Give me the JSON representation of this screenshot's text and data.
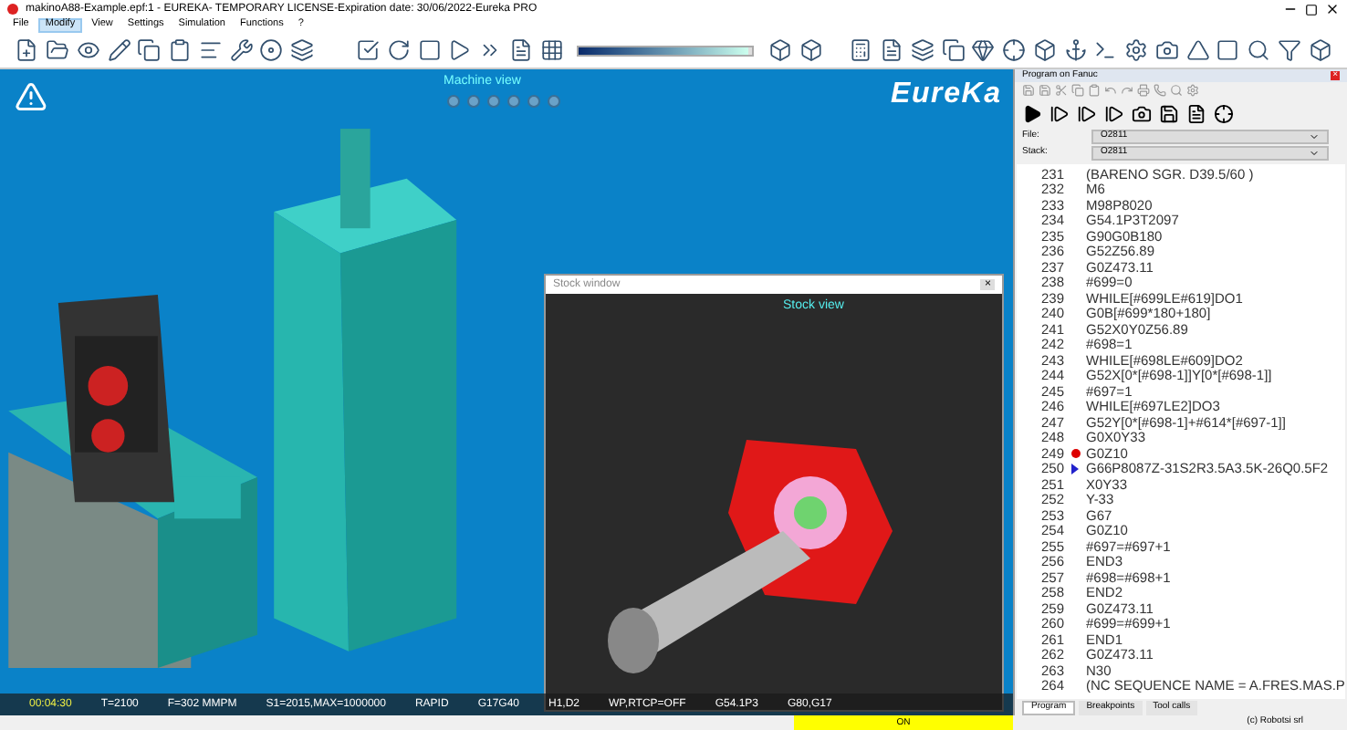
{
  "window": {
    "title": "makinoA88-Example.epf:1 - EUREKA- TEMPORARY LICENSE-Expiration date: 30/06/2022-Eureka PRO"
  },
  "menu": [
    {
      "label": "File",
      "selected": false
    },
    {
      "label": "Modify",
      "selected": true
    },
    {
      "label": "View",
      "selected": false
    },
    {
      "label": "Settings",
      "selected": false
    },
    {
      "label": "Simulation",
      "selected": false
    },
    {
      "label": "Functions",
      "selected": false
    },
    {
      "label": "?",
      "selected": false
    }
  ],
  "toolbar": {
    "speed": {
      "level": 0.98
    }
  },
  "viewport": {
    "title": "Machine view",
    "logo": "EureKa",
    "stock_window": {
      "title": "Stock window",
      "view_title": "Stock view",
      "close": "×"
    }
  },
  "status_bar": [
    "00:04:30",
    "T=2100",
    "F=302 MMPM",
    "S1=2015,MAX=1000000",
    "RAPID",
    "G17G40",
    "H1,D2",
    "WP,RTCP=OFF",
    "G54.1P3",
    "G80,G17"
  ],
  "program": {
    "title": "Program on Fanuc",
    "close": "×",
    "file": {
      "label": "File:",
      "value": "O2811"
    },
    "stack": {
      "label": "Stack:",
      "value": "O2811"
    },
    "lines": [
      {
        "n": "231",
        "code": "(BARENO SGR. D39.5/60 )",
        "breakpoint": false,
        "current": false
      },
      {
        "n": "232",
        "code": "M6",
        "breakpoint": false,
        "current": false
      },
      {
        "n": "233",
        "code": "M98P8020",
        "breakpoint": false,
        "current": false
      },
      {
        "n": "234",
        "code": "G54.1P3T2097",
        "breakpoint": false,
        "current": false
      },
      {
        "n": "235",
        "code": "G90G0B180",
        "breakpoint": false,
        "current": false
      },
      {
        "n": "236",
        "code": "G52Z56.89",
        "breakpoint": false,
        "current": false
      },
      {
        "n": "237",
        "code": "G0Z473.11",
        "breakpoint": false,
        "current": false
      },
      {
        "n": "238",
        "code": "#699=0",
        "breakpoint": false,
        "current": false
      },
      {
        "n": "239",
        "code": "WHILE[#699LE#619]DO1",
        "breakpoint": false,
        "current": false
      },
      {
        "n": "240",
        "code": "G0B[#699*180+180]",
        "breakpoint": false,
        "current": false
      },
      {
        "n": "241",
        "code": "G52X0Y0Z56.89",
        "breakpoint": false,
        "current": false
      },
      {
        "n": "242",
        "code": "#698=1",
        "breakpoint": false,
        "current": false
      },
      {
        "n": "243",
        "code": "WHILE[#698LE#609]DO2",
        "breakpoint": false,
        "current": false
      },
      {
        "n": "244",
        "code": "G52X[0*[#698-1]]Y[0*[#698-1]]",
        "breakpoint": false,
        "current": false
      },
      {
        "n": "245",
        "code": "#697=1",
        "breakpoint": false,
        "current": false
      },
      {
        "n": "246",
        "code": "WHILE[#697LE2]DO3",
        "breakpoint": false,
        "current": false
      },
      {
        "n": "247",
        "code": "G52Y[0*[#698-1]+#614*[#697-1]]",
        "breakpoint": false,
        "current": false
      },
      {
        "n": "248",
        "code": "G0X0Y33",
        "breakpoint": false,
        "current": false
      },
      {
        "n": "249",
        "code": "G0Z10",
        "breakpoint": true,
        "current": false
      },
      {
        "n": "250",
        "code": "G66P8087Z-31S2R3.5A3.5K-26Q0.5F2",
        "breakpoint": false,
        "current": true
      },
      {
        "n": "251",
        "code": "X0Y33",
        "breakpoint": false,
        "current": false
      },
      {
        "n": "252",
        "code": "Y-33",
        "breakpoint": false,
        "current": false
      },
      {
        "n": "253",
        "code": "G67",
        "breakpoint": false,
        "current": false
      },
      {
        "n": "254",
        "code": "G0Z10",
        "breakpoint": false,
        "current": false
      },
      {
        "n": "255",
        "code": "#697=#697+1",
        "breakpoint": false,
        "current": false
      },
      {
        "n": "256",
        "code": "END3",
        "breakpoint": false,
        "current": false
      },
      {
        "n": "257",
        "code": "#698=#698+1",
        "breakpoint": false,
        "current": false
      },
      {
        "n": "258",
        "code": "END2",
        "breakpoint": false,
        "current": false
      },
      {
        "n": "259",
        "code": "G0Z473.11",
        "breakpoint": false,
        "current": false
      },
      {
        "n": "260",
        "code": "#699=#699+1",
        "breakpoint": false,
        "current": false
      },
      {
        "n": "261",
        "code": "END1",
        "breakpoint": false,
        "current": false
      },
      {
        "n": "262",
        "code": "G0Z473.11",
        "breakpoint": false,
        "current": false
      },
      {
        "n": "263",
        "code": "N30",
        "breakpoint": false,
        "current": false
      },
      {
        "n": "264",
        "code": "(NC SEQUENCE NAME =  A.FRES.MAS.P",
        "breakpoint": false,
        "current": false
      }
    ],
    "tabs": [
      {
        "label": "Program",
        "selected": true
      },
      {
        "label": "Breakpoints",
        "selected": false
      },
      {
        "label": "Tool calls",
        "selected": false
      }
    ]
  },
  "footer": {
    "state": "ON",
    "copyright": "(c) Robotsi srl"
  }
}
